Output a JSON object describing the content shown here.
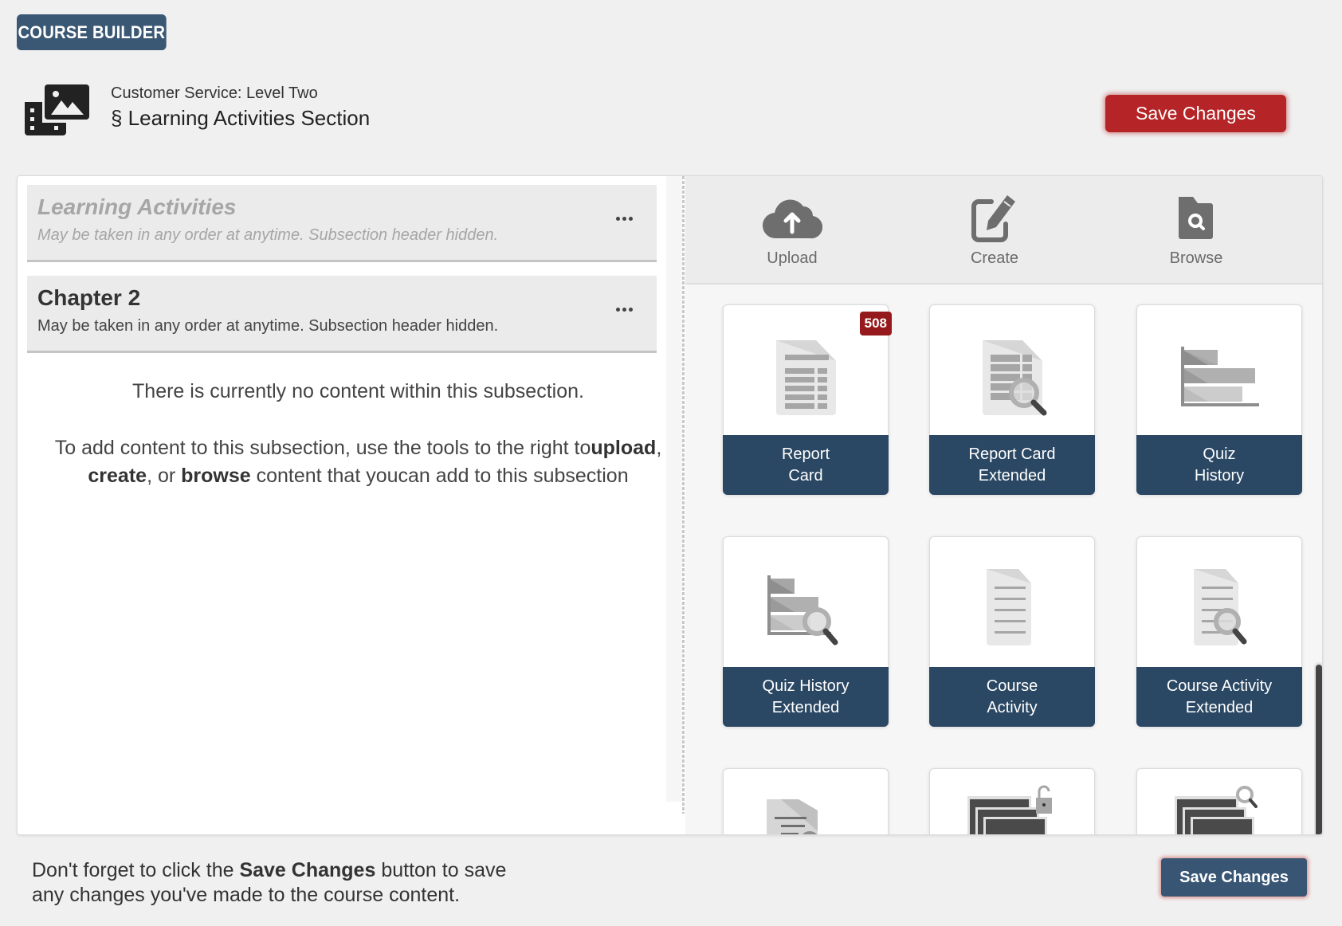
{
  "app": {
    "badge": "COURSE BUILDER"
  },
  "header": {
    "icon": "media-gallery-icon",
    "course": "Customer Service: Level Two",
    "section_title": "§ Learning Activities Section",
    "save_label": "Save Changes"
  },
  "subsections": [
    {
      "title": "Learning Activities",
      "description": "May be taken in any order at anytime. Subsection header hidden.",
      "hidden": true,
      "menu_icon": "more-horizontal-icon"
    },
    {
      "title": "Chapter 2",
      "description": "May be taken in any order at anytime. Subsection header hidden.",
      "hidden": false,
      "menu_icon": "more-horizontal-icon"
    }
  ],
  "empty_state": {
    "line1": "There is currently no content within this subsection.",
    "line2_prefix": "To add content to this subsection, use the tools to the right to",
    "upload": "upload",
    "sep1": ", ",
    "create": "create",
    "sep2": ", or ",
    "browse": "browse",
    "line2_suffix": " content that youcan add to this subsection"
  },
  "toolbar": {
    "tools": [
      {
        "label": "Upload",
        "icon": "cloud-upload-icon"
      },
      {
        "label": "Create",
        "icon": "edit-icon"
      },
      {
        "label": "Browse",
        "icon": "folder-search-icon"
      }
    ]
  },
  "cards": [
    {
      "label": "Report\nCard",
      "icon": "report-card-icon",
      "badge": "508"
    },
    {
      "label": "Report Card\nExtended",
      "icon": "report-card-search-icon"
    },
    {
      "label": "Quiz\nHistory",
      "icon": "bar-chart-icon"
    },
    {
      "label": "Quiz History\nExtended",
      "icon": "bar-chart-search-icon"
    },
    {
      "label": "Course\nActivity",
      "icon": "document-lines-icon"
    },
    {
      "label": "Course Activity\nExtended",
      "icon": "document-lines-search-icon"
    },
    {
      "label": "",
      "icon": "document-certificate-icon"
    },
    {
      "label": "",
      "icon": "screens-unlock-icon"
    },
    {
      "label": "",
      "icon": "screens-search-icon"
    }
  ],
  "footer": {
    "note_prefix": "Don't forget to click the ",
    "note_bold": "Save Changes",
    "note_suffix": " button to save any changes you've made to the course content.",
    "save_label": "Save Changes"
  },
  "colors": {
    "badge_bg": "#3a5874",
    "save_top": "#b52426",
    "card_label": "#2a4763",
    "count_badge": "#961a1d",
    "save_bottom": "#385674"
  }
}
